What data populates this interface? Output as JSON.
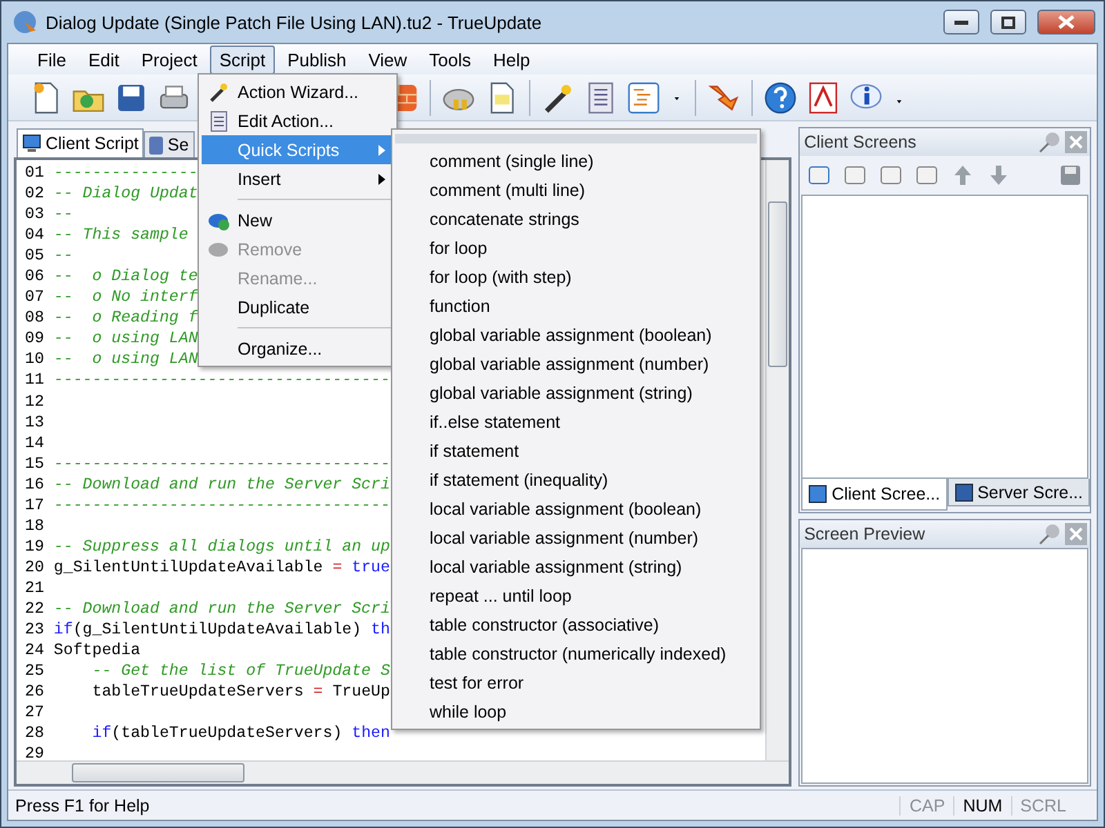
{
  "window": {
    "title": "Dialog Update (Single Patch File Using LAN).tu2 - TrueUpdate"
  },
  "menu_bar": [
    {
      "label": "File",
      "selected": false
    },
    {
      "label": "Edit",
      "selected": false
    },
    {
      "label": "Project",
      "selected": false
    },
    {
      "label": "Script",
      "selected": true
    },
    {
      "label": "Publish",
      "selected": false
    },
    {
      "label": "View",
      "selected": false
    },
    {
      "label": "Tools",
      "selected": false
    },
    {
      "label": "Help",
      "selected": false
    }
  ],
  "editor_tabs": [
    {
      "label": "Client Script",
      "selected": true
    },
    {
      "label": "Se",
      "selected": false
    }
  ],
  "code_lines": [
    {
      "number": "01",
      "segments": [
        {
          "kind": "comment",
          "text": "---------------"
        }
      ]
    },
    {
      "number": "02",
      "segments": [
        {
          "kind": "comment",
          "text": "-- Dialog Updat"
        }
      ]
    },
    {
      "number": "03",
      "segments": [
        {
          "kind": "comment",
          "text": "--"
        }
      ]
    },
    {
      "number": "04",
      "segments": [
        {
          "kind": "comment",
          "text": "-- This sample"
        }
      ]
    },
    {
      "number": "05",
      "segments": [
        {
          "kind": "comment",
          "text": "--"
        }
      ]
    },
    {
      "number": "06",
      "segments": [
        {
          "kind": "comment",
          "text": "--  o Dialog te"
        }
      ]
    },
    {
      "number": "07",
      "segments": [
        {
          "kind": "comment",
          "text": "--  o No interf"
        }
      ]
    },
    {
      "number": "08",
      "segments": [
        {
          "kind": "comment",
          "text": "--  o Reading f"
        }
      ]
    },
    {
      "number": "09",
      "segments": [
        {
          "kind": "comment",
          "text": "--  o using LAN"
        }
      ]
    },
    {
      "number": "10",
      "segments": [
        {
          "kind": "comment",
          "text": "--  o using LAN"
        }
      ]
    },
    {
      "number": "11",
      "segments": [
        {
          "kind": "comment",
          "text": "-----------------------------------"
        }
      ]
    },
    {
      "number": "12"
    },
    {
      "number": "13"
    },
    {
      "number": "14"
    },
    {
      "number": "15",
      "segments": [
        {
          "kind": "comment",
          "text": "-----------------------------------"
        }
      ]
    },
    {
      "number": "16",
      "segments": [
        {
          "kind": "comment",
          "text": "-- Download and run the Server Scri"
        }
      ]
    },
    {
      "number": "17",
      "segments": [
        {
          "kind": "comment",
          "text": "-----------------------------------"
        }
      ]
    },
    {
      "number": "18"
    },
    {
      "number": "19",
      "segments": [
        {
          "kind": "comment",
          "text": "-- Suppress all dialogs until an up"
        }
      ]
    },
    {
      "number": "20",
      "segments": [
        {
          "kind": "plain",
          "text": "g_SilentUntilUpdateAvailable "
        },
        {
          "kind": "operator",
          "text": "="
        },
        {
          "kind": "keyword",
          "text": " true"
        }
      ]
    },
    {
      "number": "21"
    },
    {
      "number": "22",
      "segments": [
        {
          "kind": "comment",
          "text": "-- Download and run the Server Scri"
        }
      ]
    },
    {
      "number": "23",
      "segments": [
        {
          "kind": "keyword",
          "text": "if"
        },
        {
          "kind": "plain",
          "text": "(g_SilentUntilUpdateAvailable) "
        },
        {
          "kind": "keyword",
          "text": "th"
        }
      ]
    },
    {
      "number": "24",
      "segments": [
        {
          "kind": "plain",
          "text": "Softpedia"
        }
      ]
    },
    {
      "number": "25",
      "segments": [
        {
          "kind": "comment",
          "text": "    -- Get the list of TrueUpdate S"
        }
      ]
    },
    {
      "number": "26",
      "segments": [
        {
          "kind": "plain",
          "text": "    tableTrueUpdateServers "
        },
        {
          "kind": "operator",
          "text": "="
        },
        {
          "kind": "plain",
          "text": " TrueUp"
        }
      ]
    },
    {
      "number": "27"
    },
    {
      "number": "28",
      "segments": [
        {
          "kind": "keyword",
          "text": "    if"
        },
        {
          "kind": "plain",
          "text": "(tableTrueUpdateServers) "
        },
        {
          "kind": "keyword",
          "text": "then"
        }
      ]
    },
    {
      "number": "29"
    }
  ],
  "script_menu": [
    {
      "kind": "item",
      "label": "Action Wizard...",
      "selected": false,
      "disabled": false,
      "submenu": false
    },
    {
      "kind": "item",
      "label": "Edit Action...",
      "selected": false,
      "disabled": false,
      "submenu": false
    },
    {
      "kind": "item",
      "label": "Quick Scripts",
      "selected": true,
      "disabled": false,
      "submenu": true
    },
    {
      "kind": "item",
      "label": "Insert",
      "selected": false,
      "disabled": false,
      "submenu": true
    },
    {
      "kind": "separator"
    },
    {
      "kind": "item",
      "label": "New",
      "selected": false,
      "disabled": false,
      "submenu": false
    },
    {
      "kind": "item",
      "label": "Remove",
      "selected": false,
      "disabled": true,
      "submenu": false
    },
    {
      "kind": "item",
      "label": "Rename...",
      "selected": false,
      "disabled": true,
      "submenu": false
    },
    {
      "kind": "item",
      "label": "Duplicate",
      "selected": false,
      "disabled": false,
      "submenu": false
    },
    {
      "kind": "separator"
    },
    {
      "kind": "item",
      "label": "Organize...",
      "selected": false,
      "disabled": false,
      "submenu": false
    }
  ],
  "quick_scripts_menu": [
    "comment (single line)",
    "comment (multi line)",
    "concatenate strings",
    "for loop",
    "for loop (with step)",
    "function",
    "global variable assignment (boolean)",
    "global variable assignment (number)",
    "global variable assignment (string)",
    "if..else statement",
    "if statement",
    "if statement (inequality)",
    "local variable assignment (boolean)",
    "local variable assignment (number)",
    "local variable assignment (string)",
    "repeat ... until loop",
    "table constructor (associative)",
    "table constructor (numerically indexed)",
    "test for error",
    "while loop"
  ],
  "client_screens_panel": {
    "title": "Client Screens",
    "tabs": [
      {
        "label": "Client Scree...",
        "selected": true
      },
      {
        "label": "Server Scre...",
        "selected": false
      }
    ]
  },
  "screen_preview_panel": {
    "title": "Screen Preview"
  },
  "status_bar": {
    "message": "Press F1 for Help",
    "indicators": [
      {
        "label": "CAP",
        "on": false
      },
      {
        "label": "NUM",
        "on": true
      },
      {
        "label": "SCRL",
        "on": false
      }
    ]
  }
}
